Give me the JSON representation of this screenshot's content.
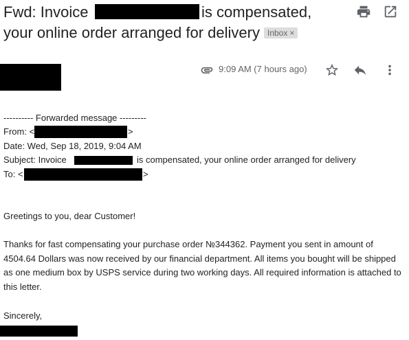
{
  "subject": {
    "part1": "Fwd: Invoice",
    "part2": "is compensated,",
    "line2": "your online order arranged for delivery",
    "badge": "Inbox",
    "badge_close": "×"
  },
  "message_meta": {
    "time": "9:09 AM (7 hours ago)"
  },
  "icons": {
    "print": "print-icon",
    "open_new_window": "open-in-new-icon",
    "attachment": "attachment-icon",
    "star": "star-icon",
    "reply": "reply-icon",
    "more": "more-vert-icon"
  },
  "forward_header": {
    "separator": "---------- Forwarded message ---------",
    "from_label": "From: <",
    "from_end": ">",
    "date_line": "Date: Wed, Sep 18, 2019, 9:04 AM",
    "subject_label": "Subject: Invoice",
    "subject_rest": "is compensated, your online order arranged for delivery",
    "to_label": "To: <",
    "to_end": ">"
  },
  "body": {
    "greeting": "Greetings to you, dear Customer!",
    "paragraph": "Thanks for fast compensating your purchase order №344362. Payment you sent in amount of 4504.64 Dollars was now received by our financial department. All items you bought will be shipped as one medium box by USPS service during two working days. All required information is attached to this letter.",
    "closing": "Sincerely,"
  },
  "colors": {
    "icon_gray": "#5f6368",
    "redaction": "#000000",
    "badge_bg": "#dddddd"
  }
}
